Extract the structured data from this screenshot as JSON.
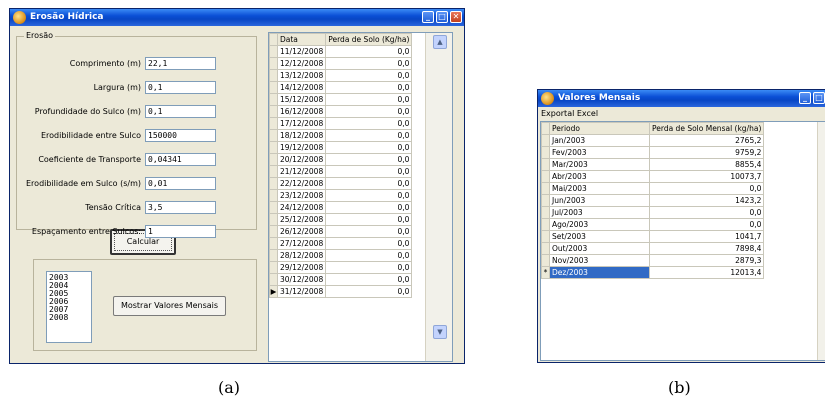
{
  "window_a": {
    "title": "Erosão Hídrica",
    "group_label": "Erosão",
    "fields": [
      {
        "label": "Comprimento (m)",
        "value": "22,1"
      },
      {
        "label": "Largura (m)",
        "value": "0,1"
      },
      {
        "label": "Profundidade do Sulco (m)",
        "value": "0,1"
      },
      {
        "label": "Erodibilidade entre Sulco",
        "value": "150000"
      },
      {
        "label": "Coeficiente de Transporte",
        "value": "0,04341"
      },
      {
        "label": "Erodibilidade em Sulco (s/m)",
        "value": "0,01"
      },
      {
        "label": "Tensão Crítica",
        "value": "3,5"
      },
      {
        "label": "Espaçamento entre Sulcos:",
        "value": "1"
      }
    ],
    "calc_button": "Calcular",
    "years": [
      "2003",
      "2004",
      "2005",
      "2006",
      "2007",
      "2008"
    ],
    "monthly_button": "Mostrar Valores Mensais",
    "grid_headers": [
      "Data",
      "Perda de Solo (Kg/ha)"
    ],
    "grid_rows": [
      [
        "11/12/2008",
        "0,0"
      ],
      [
        "12/12/2008",
        "0,0"
      ],
      [
        "13/12/2008",
        "0,0"
      ],
      [
        "14/12/2008",
        "0,0"
      ],
      [
        "15/12/2008",
        "0,0"
      ],
      [
        "16/12/2008",
        "0,0"
      ],
      [
        "17/12/2008",
        "0,0"
      ],
      [
        "18/12/2008",
        "0,0"
      ],
      [
        "19/12/2008",
        "0,0"
      ],
      [
        "20/12/2008",
        "0,0"
      ],
      [
        "21/12/2008",
        "0,0"
      ],
      [
        "22/12/2008",
        "0,0"
      ],
      [
        "23/12/2008",
        "0,0"
      ],
      [
        "24/12/2008",
        "0,0"
      ],
      [
        "25/12/2008",
        "0,0"
      ],
      [
        "26/12/2008",
        "0,0"
      ],
      [
        "27/12/2008",
        "0,0"
      ],
      [
        "28/12/2008",
        "0,0"
      ],
      [
        "29/12/2008",
        "0,0"
      ],
      [
        "30/12/2008",
        "0,0"
      ],
      [
        "31/12/2008",
        "0,0"
      ]
    ],
    "current_row_marker": "▶"
  },
  "window_b": {
    "title": "Valores Mensais",
    "menu": "Exportal Excel",
    "grid_headers": [
      "Periodo",
      "Perda de Solo Mensal (kg/ha)"
    ],
    "grid_rows": [
      [
        "Jan/2003",
        "2765,2"
      ],
      [
        "Fev/2003",
        "9759,2"
      ],
      [
        "Mar/2003",
        "8855,4"
      ],
      [
        "Abr/2003",
        "10073,7"
      ],
      [
        "Mai/2003",
        "0,0"
      ],
      [
        "Jun/2003",
        "1423,2"
      ],
      [
        "Jul/2003",
        "0,0"
      ],
      [
        "Ago/2003",
        "0,0"
      ],
      [
        "Set/2003",
        "1041,7"
      ],
      [
        "Out/2003",
        "7898,4"
      ],
      [
        "Nov/2003",
        "2879,3"
      ],
      [
        "Dez/2003",
        "12013,4"
      ]
    ],
    "new_row_marker": "*"
  },
  "captions": {
    "a": "(a)",
    "b": "(b)"
  },
  "colors": {
    "titlebar": "#0846c5",
    "window_bg": "#ece9d8",
    "selection": "#316ac5"
  }
}
